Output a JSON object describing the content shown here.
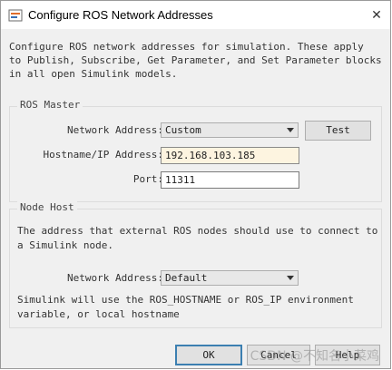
{
  "window": {
    "title": "Configure ROS Network Addresses",
    "close_glyph": "✕"
  },
  "description": [
    "Configure ROS network addresses for simulation. These apply",
    "to Publish, Subscribe, Get Parameter, and Set Parameter blocks",
    "in all open Simulink models."
  ],
  "ros_master": {
    "group_label": "ROS Master",
    "network_address_label": "Network Address:",
    "network_address_value": "Custom",
    "test_label": "Test",
    "hostname_label": "Hostname/IP Address:",
    "hostname_value": "192.168.103.185",
    "port_label": "Port:",
    "port_value": "11311"
  },
  "node_host": {
    "group_label": "Node Host",
    "intro": [
      "The address that external ROS nodes should use to connect to",
      "a Simulink node."
    ],
    "network_address_label": "Network Address:",
    "network_address_value": "Default",
    "note": [
      "Simulink will use the ROS_HOSTNAME or ROS_IP environment",
      "variable, or local hostname"
    ]
  },
  "buttons": {
    "ok": "OK",
    "cancel": "Cancel",
    "help": "Help"
  },
  "watermark": "CSDN @不知名小菜鸡",
  "colors": {
    "highlight_input": "#fdf4e0",
    "default_button_border": "#3c7fb1"
  }
}
